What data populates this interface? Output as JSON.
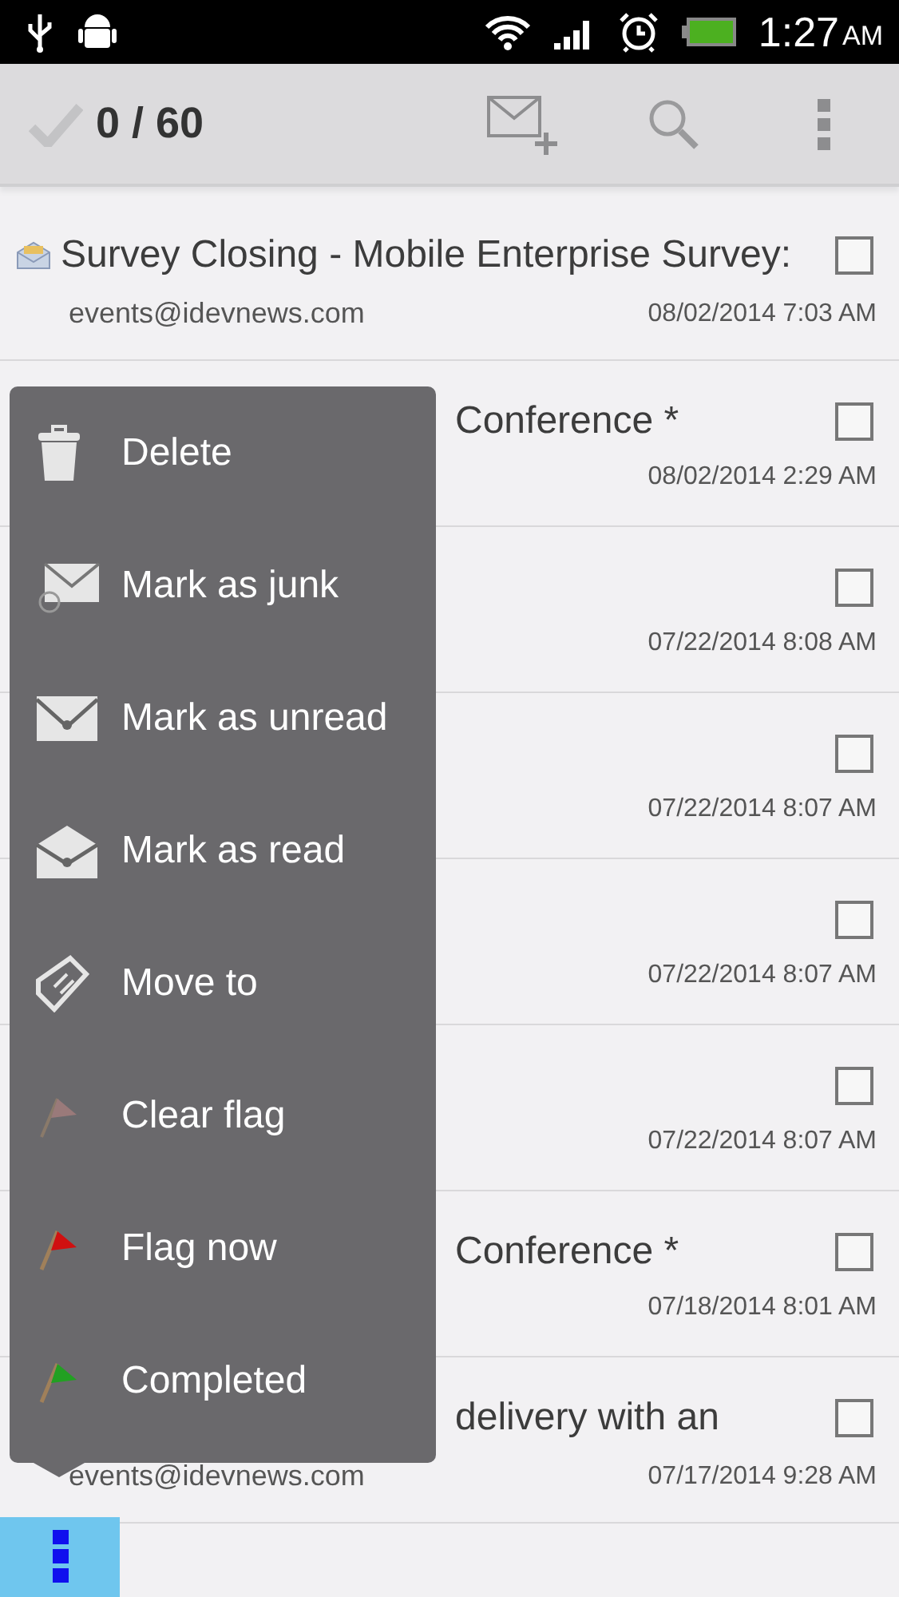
{
  "status_bar": {
    "time": "1:27",
    "ampm": "AM"
  },
  "action_bar": {
    "count": "0 / 60"
  },
  "messages": [
    {
      "kind": "full",
      "envelope": true,
      "subject": "Survey Closing - Mobile Enterprise Survey:",
      "sender": "events@idevnews.com",
      "date": "08/02/2014 7:03 AM",
      "checked": false
    },
    {
      "kind": "partial",
      "subject": "Conference *",
      "date": "08/02/2014 2:29 AM",
      "checked": false
    },
    {
      "kind": "partial",
      "date": "07/22/2014 8:08 AM",
      "checked": false
    },
    {
      "kind": "partial",
      "date": "07/22/2014 8:07 AM",
      "checked": false
    },
    {
      "kind": "partial",
      "date": "07/22/2014 8:07 AM",
      "checked": false
    },
    {
      "kind": "partial",
      "date": "07/22/2014 8:07 AM",
      "checked": false
    },
    {
      "kind": "partial",
      "subject": "Conference *",
      "date": "07/18/2014 8:01 AM",
      "checked": false
    },
    {
      "kind": "partial",
      "subject": "delivery with an",
      "sender": "events@idevnews.com",
      "date": "07/17/2014 9:28 AM",
      "checked": false
    }
  ],
  "menu": [
    {
      "label": "Delete",
      "kind": "trash"
    },
    {
      "label": "Mark as junk",
      "kind": "junk"
    },
    {
      "label": "Mark as unread",
      "kind": "unread"
    },
    {
      "label": "Mark as read",
      "kind": "read"
    },
    {
      "label": "Move to",
      "kind": "tag"
    },
    {
      "label": "Clear flag",
      "kind": "clearflag"
    },
    {
      "label": "Flag now",
      "kind": "redflag"
    },
    {
      "label": "Completed",
      "kind": "greenflag"
    }
  ]
}
